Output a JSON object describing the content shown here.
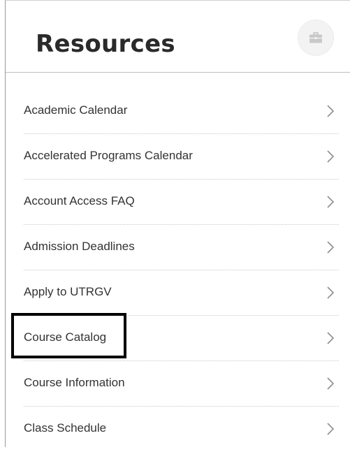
{
  "header": {
    "title": "Resources",
    "icon": "briefcase-icon"
  },
  "resources": {
    "items": [
      {
        "label": "Academic Calendar"
      },
      {
        "label": "Accelerated Programs Calendar"
      },
      {
        "label": "Account Access FAQ"
      },
      {
        "label": "Admission Deadlines"
      },
      {
        "label": "Apply to UTRGV"
      },
      {
        "label": "Course Catalog",
        "highlighted": true
      },
      {
        "label": "Course Information"
      },
      {
        "label": "Class Schedule"
      }
    ],
    "row_icon": "chevron-right-icon"
  },
  "colors": {
    "title": "#2a2a2a",
    "text": "#333333",
    "chevron": "#8f8f8f",
    "divider": "#c9c9c9",
    "icon_bg": "#f3f3f3",
    "highlight": "#000000"
  }
}
